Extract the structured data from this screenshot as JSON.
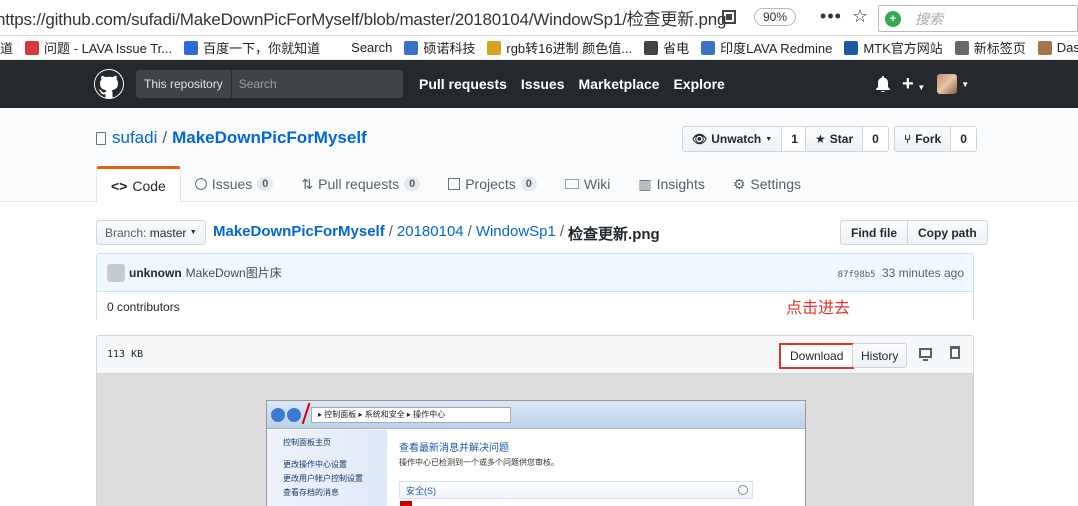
{
  "browser": {
    "url": "https://github.com/sufadi/MakeDownPicForMyself/blob/master/20180104/WindowSp1/检查更新.png",
    "zoom": "90%",
    "more_label": "•••",
    "search_placeholder": "搜索"
  },
  "bookmarks": [
    {
      "label": "道",
      "icon_color": "#ffffff"
    },
    {
      "label": "问题 - LAVA Issue Tr...",
      "icon_color": "#d9383a"
    },
    {
      "label": "百度一下，你就知道",
      "icon_color": "#2f6ad9"
    },
    {
      "label": "Search",
      "icon_color": "#ffffff"
    },
    {
      "label": "硕诺科技",
      "icon_color": "#3b72c9"
    },
    {
      "label": "rgb转16进制 颜色值...",
      "icon_color": "#d9a021"
    },
    {
      "label": "省电",
      "icon_color": "#444444"
    },
    {
      "label": "印度LAVA Redmine",
      "icon_color": "#3b72c9"
    },
    {
      "label": "MTK官方网站",
      "icon_color": "#1d58a8"
    },
    {
      "label": "新标签页",
      "icon_color": "#666666"
    },
    {
      "label": "Dashbo",
      "icon_color": "#a7744a"
    }
  ],
  "header": {
    "scope_label": "This repository",
    "search_placeholder": "Search",
    "nav": [
      "Pull requests",
      "Issues",
      "Marketplace",
      "Explore"
    ]
  },
  "repo": {
    "owner": "sufadi",
    "name": "MakeDownPicForMyself",
    "watch_label": "Unwatch",
    "watch_count": "1",
    "star_label": "Star",
    "star_count": "0",
    "fork_label": "Fork",
    "fork_count": "0"
  },
  "tabs": [
    {
      "label": "Code",
      "counter": ""
    },
    {
      "label": "Issues",
      "counter": "0"
    },
    {
      "label": "Pull requests",
      "counter": "0"
    },
    {
      "label": "Projects",
      "counter": "0"
    },
    {
      "label": "Wiki",
      "counter": ""
    },
    {
      "label": "Insights",
      "counter": ""
    },
    {
      "label": "Settings",
      "counter": ""
    }
  ],
  "file_nav": {
    "branch_label": "Branch:",
    "branch": "master",
    "path_root": "MakeDownPicForMyself",
    "path_1": "20180104",
    "path_2": "WindowSp1",
    "file_name": "检查更新.png",
    "find_file": "Find file",
    "copy_path": "Copy path"
  },
  "commit": {
    "author": "unknown",
    "message": "MakeDown图片床",
    "sha": "87f98b5",
    "time": "33 minutes ago",
    "contributors": "0 contributors"
  },
  "annotation": "点击进去",
  "file": {
    "size": "113 KB",
    "download": "Download",
    "history": "History"
  },
  "embedded_image": {
    "crumb": "▸ 控制面板 ▸ 系统和安全 ▸ 操作中心",
    "sidebar": [
      "控制面板主页",
      "更改操作中心设置",
      "更改用户帐户控制设置",
      "查看存档的消息"
    ],
    "heading": "查看最新消息并解决问题",
    "subtext": "操作中心已检测到一个或多个问题供您审核。",
    "section": "安全(S)"
  }
}
